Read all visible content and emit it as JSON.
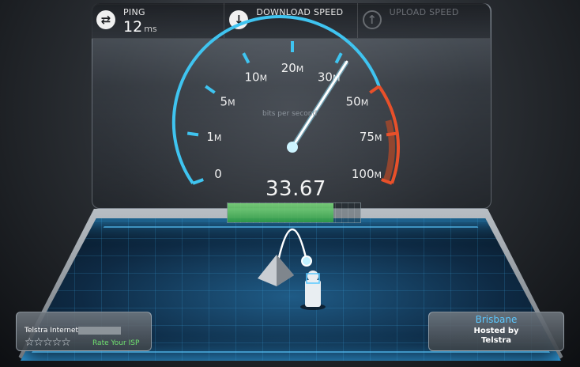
{
  "topbar": {
    "ping": {
      "label": "PING",
      "value": "12",
      "unit": "ms",
      "icon": "swap-arrows-icon"
    },
    "download": {
      "label": "DOWNLOAD SPEED",
      "icon": "arrow-down-icon"
    },
    "upload": {
      "label": "UPLOAD SPEED",
      "icon": "arrow-up-icon"
    }
  },
  "gauge": {
    "units_label": "bits per second",
    "reading": "33.67",
    "reading_value": 33.67,
    "ticks": [
      {
        "num": "0",
        "suffix": ""
      },
      {
        "num": "1",
        "suffix": "M"
      },
      {
        "num": "5",
        "suffix": "M"
      },
      {
        "num": "10",
        "suffix": "M"
      },
      {
        "num": "20",
        "suffix": "M"
      },
      {
        "num": "30",
        "suffix": "M"
      },
      {
        "num": "50",
        "suffix": "M"
      },
      {
        "num": "75",
        "suffix": "M"
      },
      {
        "num": "100",
        "suffix": "M"
      }
    ],
    "progress_fraction": 0.8,
    "colors": {
      "arc": "#3fc4f0",
      "redzone": "#e8502a",
      "needle": "#ffffff"
    }
  },
  "isp": {
    "name": "Telstra Internet",
    "rating_stars": "☆☆☆☆☆",
    "rate_label": "Rate Your ISP"
  },
  "server": {
    "city": "Brisbane",
    "hosted_by": "Hosted by",
    "sponsor": "Telstra"
  }
}
